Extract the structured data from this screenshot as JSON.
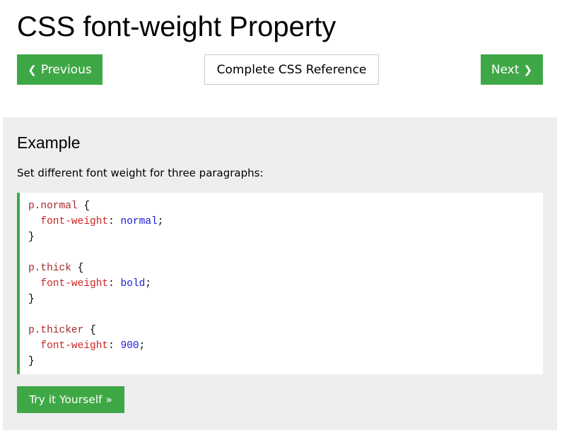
{
  "page": {
    "title": "CSS font-weight Property"
  },
  "nav": {
    "previous_label": "Previous",
    "previous_chevron": "❮",
    "reference_label": "Complete CSS Reference",
    "next_label": "Next",
    "next_chevron": "❯"
  },
  "example": {
    "heading": "Example",
    "description": "Set different font weight for three paragraphs:",
    "code": [
      {
        "selector": "p.normal",
        "property": "font-weight",
        "value": "normal"
      },
      {
        "selector": "p.thick",
        "property": "font-weight",
        "value": "bold"
      },
      {
        "selector": "p.thicker",
        "property": "font-weight",
        "value": "900"
      }
    ],
    "syntax": {
      "open_brace": " {",
      "close_brace": "}",
      "colon": ": ",
      "semicolon": ";",
      "indent": "  "
    },
    "try_label": "Try it Yourself »"
  },
  "colors": {
    "accent_green": "#3fa846",
    "panel_background": "#eeeeee",
    "code_selector": "#a52a2a",
    "code_property": "#cc2222",
    "code_value": "#1a1adb"
  },
  "icons": {
    "previous": "chevron-left-icon",
    "next": "chevron-right-icon"
  }
}
